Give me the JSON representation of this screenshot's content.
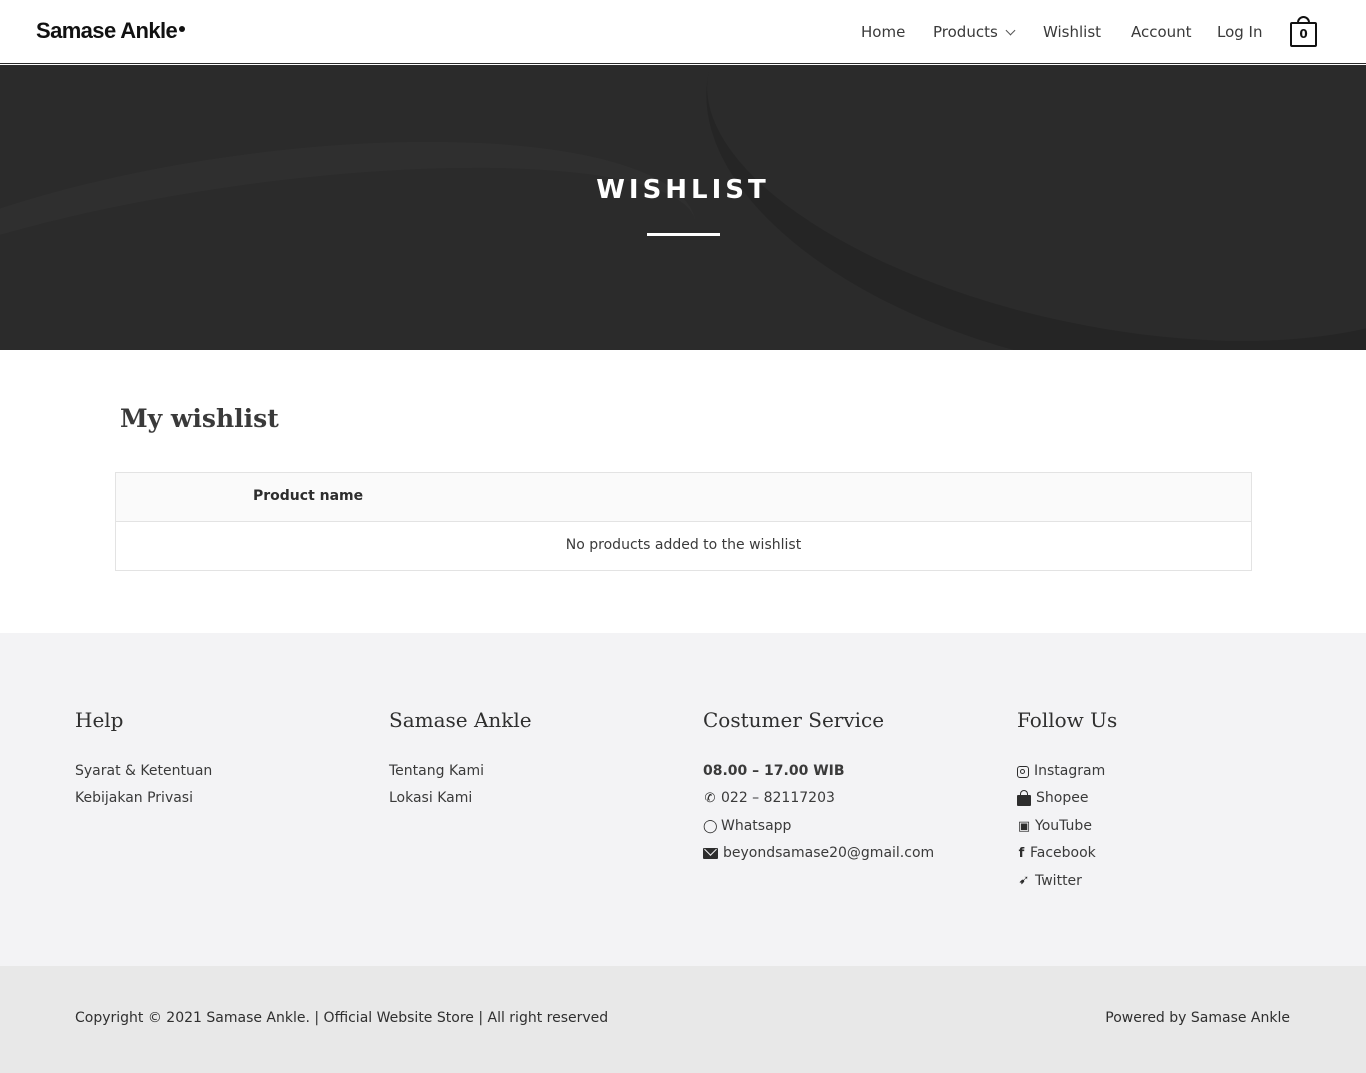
{
  "header": {
    "logo": "Samase Ankle",
    "nav": {
      "home": "Home",
      "products": "Products",
      "wishlist": "Wishlist",
      "account": "Account",
      "login": "Log In"
    },
    "cart_count": "0"
  },
  "hero": {
    "title": "WISHLIST"
  },
  "wishlist": {
    "title": "My wishlist",
    "column_product_name": "Product name",
    "empty_message": "No products added to the wishlist"
  },
  "footer": {
    "help": {
      "heading": "Help",
      "links": [
        "Syarat & Ketentuan",
        "Kebijakan Privasi"
      ]
    },
    "brand": {
      "heading": "Samase Ankle",
      "links": [
        "Tentang Kami",
        "Lokasi Kami"
      ]
    },
    "service": {
      "heading": "Costumer Service",
      "hours": "08.00 – 17.00 WIB",
      "phone": "022 – 82117203",
      "whatsapp": "Whatsapp",
      "email": "beyondsamase20@gmail.com"
    },
    "follow": {
      "heading": "Follow Us",
      "instagram": "Instagram",
      "shopee": "Shopee",
      "youtube": "YouTube",
      "facebook": "Facebook",
      "twitter": "Twitter"
    },
    "copyright": "Copyright © 2021 Samase Ankle. | Official Website Store | All right reserved",
    "powered": "Powered by Samase Ankle"
  },
  "icons": {
    "cart": "shopping-bag-icon",
    "products_dropdown": "chevron-down-icon",
    "phone": "phone-icon",
    "whatsapp": "whatsapp-icon",
    "email": "envelope-icon",
    "instagram": "instagram-icon",
    "shopee": "shopee-bag-icon",
    "youtube": "youtube-icon",
    "facebook": "facebook-icon",
    "twitter": "twitter-icon"
  },
  "colors": {
    "hero_bg": "#2b2b2b",
    "footer_bg": "#f3f3f5",
    "bottom_bar_bg": "#e8e8e8",
    "text": "#3a3a3a"
  }
}
